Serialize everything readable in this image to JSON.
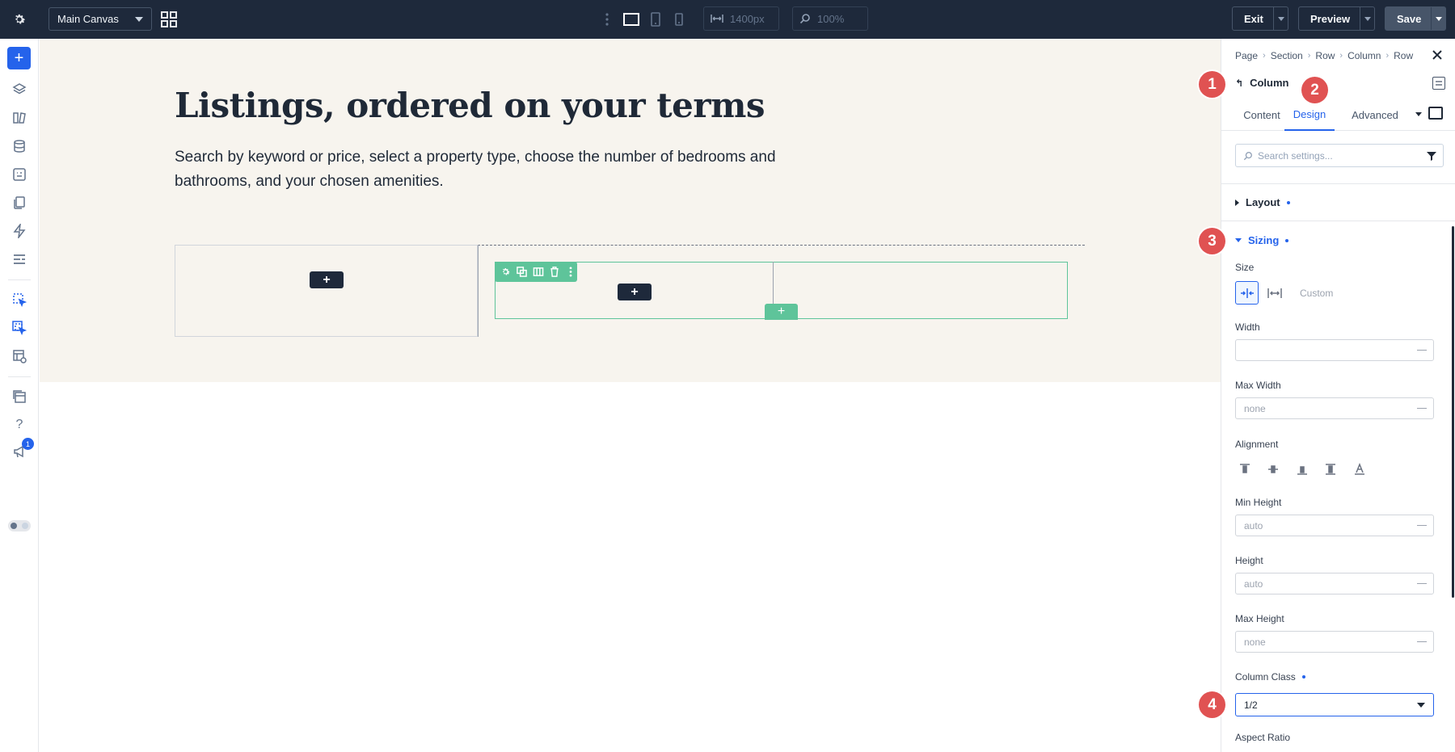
{
  "topbar": {
    "canvas_name": "Main Canvas",
    "width_value": "1400px",
    "zoom_value": "100%",
    "exit_label": "Exit",
    "preview_label": "Preview",
    "save_label": "Save"
  },
  "rail": {
    "notification_count": "1",
    "icons": [
      "add-icon",
      "layers-icon",
      "library-icon",
      "database-icon",
      "form-icon",
      "pages-icon",
      "lightning-icon",
      "list-icon",
      "pointer-select-icon",
      "pointer-multi-icon",
      "template-settings-icon",
      "layout-icon",
      "help-icon",
      "megaphone-icon",
      "toggle-icon"
    ]
  },
  "canvas": {
    "title": "Listings, ordered on your terms",
    "description": "Search by keyword or price, select a property type, choose the number of bedrooms and bathrooms, and your chosen amenities."
  },
  "panel": {
    "breadcrumb": [
      "Page",
      "Section",
      "Row",
      "Column",
      "Row"
    ],
    "element_name": "Column",
    "tabs": [
      {
        "label": "Content",
        "active": false
      },
      {
        "label": "Design",
        "active": true
      },
      {
        "label": "Advanced",
        "active": false
      }
    ],
    "search_placeholder": "Search settings...",
    "groups": {
      "layout": "Layout",
      "sizing": "Sizing"
    },
    "fields": {
      "size_label": "Size",
      "size_custom": "Custom",
      "width_label": "Width",
      "width_value": "",
      "max_width_label": "Max Width",
      "max_width_value": "none",
      "alignment_label": "Alignment",
      "min_height_label": "Min Height",
      "min_height_value": "auto",
      "height_label": "Height",
      "height_value": "auto",
      "max_height_label": "Max Height",
      "max_height_value": "none",
      "column_class_label": "Column Class",
      "column_class_value": "1/2",
      "aspect_ratio_label": "Aspect Ratio"
    }
  },
  "markers": [
    "1",
    "2",
    "3",
    "4"
  ],
  "colors": {
    "topbar_bg": "#1e293b",
    "accent": "#2563eb",
    "builder_green": "#5ec49a",
    "marker_red": "#e05252",
    "hero_bg": "#f7f4ee"
  }
}
